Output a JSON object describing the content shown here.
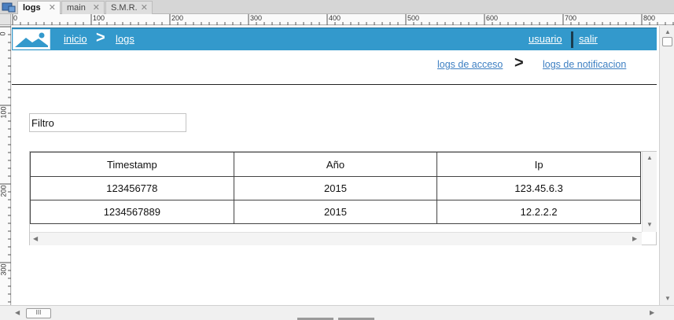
{
  "tabs": [
    {
      "label": "logs",
      "active": true
    },
    {
      "label": "main",
      "active": false
    },
    {
      "label": "S.M.R.",
      "active": false
    }
  ],
  "ruler": {
    "h_labels": [
      "0",
      "100",
      "200",
      "300",
      "400",
      "500",
      "600",
      "700",
      "800"
    ],
    "v_labels": [
      "0",
      "100",
      "200",
      "300"
    ]
  },
  "nav": {
    "inicio": "inicio",
    "separator": ">",
    "logs": "logs",
    "usuario": "usuario",
    "salir": "salir"
  },
  "subnav": {
    "acceso": "logs de acceso",
    "separator": ">",
    "notificacion": "logs de notificacion"
  },
  "filter": {
    "value": "Filtro"
  },
  "table": {
    "headers": [
      "Timestamp",
      "Año",
      "Ip"
    ],
    "rows": [
      [
        "123456778",
        "2015",
        "123.45.6.3"
      ],
      [
        "1234567889",
        "2015",
        "12.2.2.2"
      ]
    ]
  },
  "scrollbar_thumb": "III",
  "colors": {
    "navbar": "#3399cc",
    "link": "#3d7fc2"
  }
}
